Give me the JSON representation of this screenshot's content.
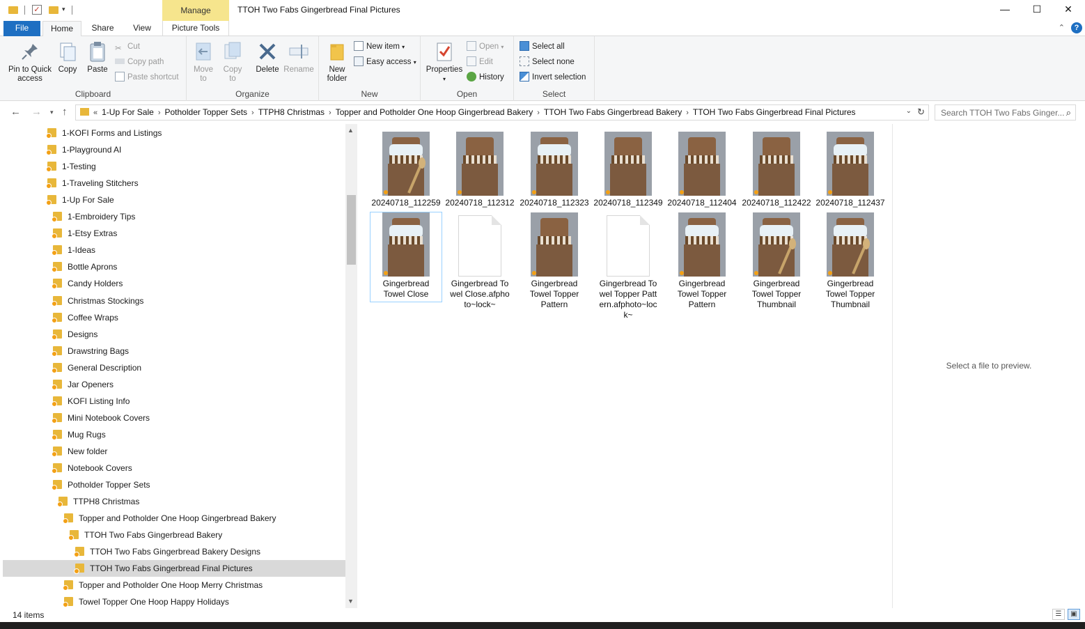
{
  "window": {
    "title": "TTOH Two Fabs Gingerbread Final Pictures",
    "manage_label": "Manage",
    "min_glyph": "—",
    "max_glyph": "☐",
    "close_glyph": "✕"
  },
  "tabs": {
    "file": "File",
    "home": "Home",
    "share": "Share",
    "view": "View",
    "picture_tools": "Picture Tools"
  },
  "ribbon": {
    "clipboard": {
      "label": "Clipboard",
      "pin": "Pin to Quick access",
      "copy": "Copy",
      "paste": "Paste",
      "cut": "Cut",
      "copy_path": "Copy path",
      "paste_shortcut": "Paste shortcut"
    },
    "organize": {
      "label": "Organize",
      "move_to": "Move to",
      "copy_to": "Copy to",
      "delete": "Delete",
      "rename": "Rename"
    },
    "new": {
      "label": "New",
      "new_folder": "New folder",
      "new_item": "New item",
      "easy_access": "Easy access"
    },
    "open": {
      "label": "Open",
      "properties": "Properties",
      "open": "Open",
      "edit": "Edit",
      "history": "History"
    },
    "select": {
      "label": "Select",
      "select_all": "Select all",
      "select_none": "Select none",
      "invert_selection": "Invert selection"
    }
  },
  "address": {
    "crumbs": [
      "1-Up For Sale",
      "Potholder Topper Sets",
      "TTPH8 Christmas",
      "Topper and Potholder One Hoop Gingerbread Bakery",
      "TTOH Two Fabs Gingerbread Bakery",
      "TTOH Two Fabs Gingerbread Final Pictures"
    ],
    "search_placeholder": "Search TTOH Two Fabs Ginger..."
  },
  "tree": [
    {
      "label": "1-KOFI Forms and Listings",
      "indent": 0
    },
    {
      "label": "1-Playground AI",
      "indent": 0
    },
    {
      "label": "1-Testing",
      "indent": 0
    },
    {
      "label": "1-Traveling Stitchers",
      "indent": 0
    },
    {
      "label": "1-Up For Sale",
      "indent": 0
    },
    {
      "label": "1-Embroidery Tips",
      "indent": 1
    },
    {
      "label": "1-Etsy Extras",
      "indent": 1
    },
    {
      "label": "1-Ideas",
      "indent": 1
    },
    {
      "label": "Bottle Aprons",
      "indent": 1
    },
    {
      "label": "Candy Holders",
      "indent": 1
    },
    {
      "label": "Christmas Stockings",
      "indent": 1
    },
    {
      "label": "Coffee Wraps",
      "indent": 1
    },
    {
      "label": "Designs",
      "indent": 1
    },
    {
      "label": "Drawstring Bags",
      "indent": 1
    },
    {
      "label": "General Description",
      "indent": 1
    },
    {
      "label": "Jar Openers",
      "indent": 1
    },
    {
      "label": "KOFI Listing Info",
      "indent": 1
    },
    {
      "label": "Mini Notebook Covers",
      "indent": 1
    },
    {
      "label": "Mug Rugs",
      "indent": 1
    },
    {
      "label": "New folder",
      "indent": 1
    },
    {
      "label": "Notebook Covers",
      "indent": 1
    },
    {
      "label": "Potholder Topper Sets",
      "indent": 1
    },
    {
      "label": "TTPH8 Christmas",
      "indent": 2
    },
    {
      "label": "Topper and Potholder One Hoop Gingerbread Bakery",
      "indent": 3
    },
    {
      "label": "TTOH Two Fabs Gingerbread Bakery",
      "indent": 4
    },
    {
      "label": "TTOH Two Fabs Gingerbread Bakery Designs",
      "indent": 5
    },
    {
      "label": "TTOH Two Fabs Gingerbread Final Pictures",
      "indent": 5,
      "selected": true
    },
    {
      "label": "Topper and Potholder One Hoop Merry Christmas",
      "indent": 3
    },
    {
      "label": "Towel Topper One Hoop Happy Holidays",
      "indent": 3
    }
  ],
  "files": [
    {
      "name": "20240718_112259",
      "kind": "photo",
      "style": "spoon"
    },
    {
      "name": "20240718_112312",
      "kind": "photo",
      "style": "plain"
    },
    {
      "name": "20240718_112323",
      "kind": "photo",
      "style": "label"
    },
    {
      "name": "20240718_112349",
      "kind": "photo",
      "style": "hanger"
    },
    {
      "name": "20240718_112404",
      "kind": "photo",
      "style": "check"
    },
    {
      "name": "20240718_112422",
      "kind": "photo",
      "style": "check"
    },
    {
      "name": "20240718_112437",
      "kind": "photo",
      "style": "label"
    },
    {
      "name": "Gingerbread Towel Close",
      "kind": "photo",
      "style": "label",
      "selected": true
    },
    {
      "name": "Gingerbread Towel Close.afphoto~lock~",
      "kind": "blank"
    },
    {
      "name": "Gingerbread Towel Topper Pattern",
      "kind": "photo",
      "style": "plain"
    },
    {
      "name": "Gingerbread Towel Topper Pattern.afphoto~lock~",
      "kind": "blank"
    },
    {
      "name": "Gingerbread Towel Topper Pattern",
      "kind": "photo",
      "style": "label"
    },
    {
      "name": "Gingerbread Towel Topper Thumbnail",
      "kind": "photo",
      "style": "spoon"
    },
    {
      "name": "Gingerbread Towel Topper Thumbnail",
      "kind": "photo",
      "style": "spoon"
    }
  ],
  "preview": {
    "message": "Select a file to preview."
  },
  "status": {
    "item_count": "14 items"
  },
  "colors": {
    "accent": "#1e6fc2",
    "folder": "#e8b73a",
    "manage": "#f6e58d",
    "selected_tree": "#d9d9d9"
  }
}
